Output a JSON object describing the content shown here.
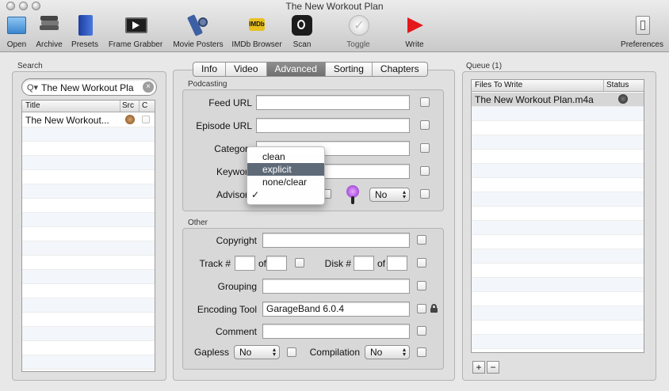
{
  "window": {
    "title": "The New Workout Plan"
  },
  "toolbar": {
    "open": "Open",
    "archive": "Archive",
    "presets": "Presets",
    "frame_grabber": "Frame Grabber",
    "movie_posters": "Movie Posters",
    "imdb_browser": "IMDb Browser",
    "scan": "Scan",
    "toggle": "Toggle",
    "write": "Write",
    "preferences": "Preferences"
  },
  "search": {
    "label": "Search",
    "query": "The New Workout Pla",
    "columns": {
      "title": "Title",
      "src": "Src",
      "c": "C"
    },
    "rows": [
      {
        "title": "The New Workout..."
      }
    ]
  },
  "tabs": [
    "Info",
    "Video",
    "Advanced",
    "Sorting",
    "Chapters"
  ],
  "podcasting": {
    "label": "Podcasting",
    "feed_url": "Feed URL",
    "episode_url": "Episode URL",
    "category": "Categor",
    "keywords": "Keywor",
    "advisory": "Advisor",
    "advisory_popup": "No"
  },
  "advisory_menu": {
    "items": [
      "clean",
      "explicit",
      "none/clear"
    ],
    "check": "✓"
  },
  "other": {
    "label": "Other",
    "copyright": "Copyright",
    "track": "Track #",
    "of": "of",
    "disk": "Disk #",
    "grouping": "Grouping",
    "encoding_tool": "Encoding Tool",
    "encoding_tool_value": "GarageBand 6.0.4",
    "comment": "Comment",
    "gapless": "Gapless",
    "gapless_value": "No",
    "compilation": "Compilation",
    "compilation_value": "No"
  },
  "queue": {
    "label": "Queue (1)",
    "columns": {
      "files": "Files To Write",
      "status": "Status"
    },
    "rows": [
      {
        "file": "The New Workout Plan.m4a"
      }
    ],
    "add": "+",
    "remove": "−"
  }
}
